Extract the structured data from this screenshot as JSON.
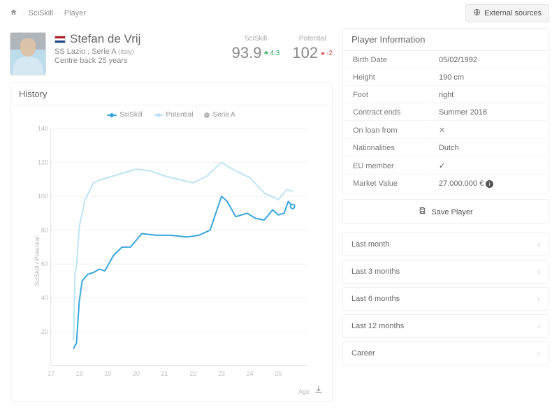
{
  "breadcrumb": {
    "sciskill": "SciSkill",
    "player": "Player"
  },
  "external_btn": "External sources",
  "player": {
    "name": "Stefan de Vrij",
    "club": "SS Lazio",
    "league": "Serie A",
    "country": "(Italy)",
    "position": "Centre back",
    "age": "25 years"
  },
  "scores": {
    "sciskill_label": "SciSkill",
    "sciskill_value": "93.9",
    "sciskill_delta": "4.3",
    "potential_label": "Potential",
    "potential_value": "102",
    "potential_delta": "-2"
  },
  "history_title": "History",
  "legend": {
    "sciskill": "SciSkill",
    "potential": "Potential",
    "seriea": "Serie A"
  },
  "axes": {
    "ylabel": "SciSkill / Potential",
    "xlabel": "Age"
  },
  "info": {
    "title": "Player Information",
    "rows": [
      {
        "k": "Birth Date",
        "v": "05/02/1992"
      },
      {
        "k": "Height",
        "v": "190 cm"
      },
      {
        "k": "Foot",
        "v": "right"
      },
      {
        "k": "Contract ends",
        "v": "Summer 2018"
      },
      {
        "k": "On loan from",
        "v": "✕"
      },
      {
        "k": "Nationalities",
        "v": "Dutch"
      },
      {
        "k": "EU member",
        "v": "✓"
      },
      {
        "k": "Market Value",
        "v": "27.000.000 €"
      }
    ]
  },
  "save_label": "Save Player",
  "periods": [
    "Last month",
    "Last 3 months",
    "Last 6 months",
    "Last 12 months",
    "Career"
  ],
  "chart_data": {
    "type": "line",
    "xlabel": "Age",
    "ylabel": "SciSkill / Potential",
    "xlim": [
      17,
      26
    ],
    "ylim": [
      0,
      140
    ],
    "x_ticks": [
      17,
      18,
      19,
      20,
      21,
      22,
      23,
      24,
      25
    ],
    "y_ticks": [
      20,
      40,
      60,
      80,
      100,
      120,
      140
    ],
    "series": [
      {
        "name": "SciSkill",
        "color": "#3ba6dd",
        "x": [
          17.8,
          17.85,
          17.9,
          18.0,
          18.1,
          18.2,
          18.3,
          18.5,
          18.7,
          18.9,
          19.2,
          19.5,
          19.8,
          20.2,
          20.7,
          21.2,
          21.8,
          22.2,
          22.6,
          22.8,
          23.0,
          23.2,
          23.5,
          23.9,
          24.2,
          24.5,
          24.8,
          25.0,
          25.2,
          25.35,
          25.5
        ],
        "y": [
          10,
          12,
          13,
          38,
          50,
          52,
          54,
          55,
          57,
          56,
          65,
          70,
          70,
          78,
          77,
          77,
          76,
          77,
          80,
          90,
          100,
          97,
          88,
          90,
          87,
          86,
          92,
          89,
          90,
          97,
          94
        ]
      },
      {
        "name": "Potential",
        "color": "#bfe3f4",
        "x": [
          17.8,
          17.85,
          17.9,
          18.0,
          18.2,
          18.5,
          18.8,
          19.2,
          19.6,
          20.0,
          20.5,
          21.0,
          21.5,
          22.0,
          22.5,
          22.8,
          23.0,
          23.5,
          24.0,
          24.5,
          25.0,
          25.3,
          25.5
        ],
        "y": [
          15,
          55,
          58,
          82,
          98,
          108,
          110,
          112,
          114,
          116,
          115,
          112,
          110,
          108,
          112,
          117,
          120,
          115,
          111,
          102,
          98,
          104,
          103
        ]
      }
    ]
  }
}
